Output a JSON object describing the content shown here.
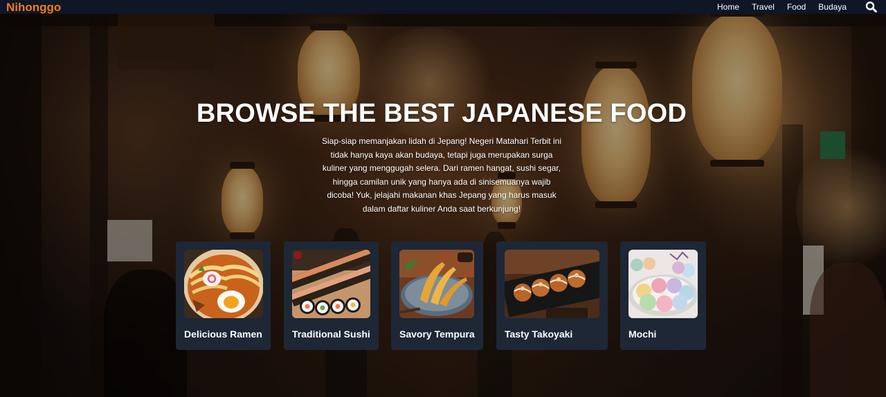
{
  "navbar": {
    "brand": "Nihonggo",
    "links": [
      "Home",
      "Travel",
      "Food",
      "Budaya"
    ],
    "search_icon": "search-icon",
    "brand_color": "#f07a1a",
    "background": "#0f1626"
  },
  "hero": {
    "title": "BROWSE THE BEST JAPANESE FOOD",
    "description": "Siap-siap memanjakan lidah di Jepang! Negeri Matahari Terbit ini tidak hanya kaya akan budaya, tetapi juga merupakan surga kuliner yang menggugah selera. Dari ramen hangat, sushi segar, hingga camilan unik yang hanya ada di sinisemuanya wajib dicoba! Yuk, jelajahi makanan khas Jepang yang harus masuk dalam daftar kuliner Anda saat berkunjung!"
  },
  "cards": [
    {
      "label": "Delicious Ramen",
      "image": "ramen-bowl"
    },
    {
      "label": "Traditional Sushi",
      "image": "sushi-platter"
    },
    {
      "label": "Savory Tempura",
      "image": "tempura-plate"
    },
    {
      "label": "Tasty Takoyaki",
      "image": "takoyaki-plate"
    },
    {
      "label": "Mochi",
      "image": "mochi-plate"
    }
  ],
  "card_color": "#1d2736"
}
